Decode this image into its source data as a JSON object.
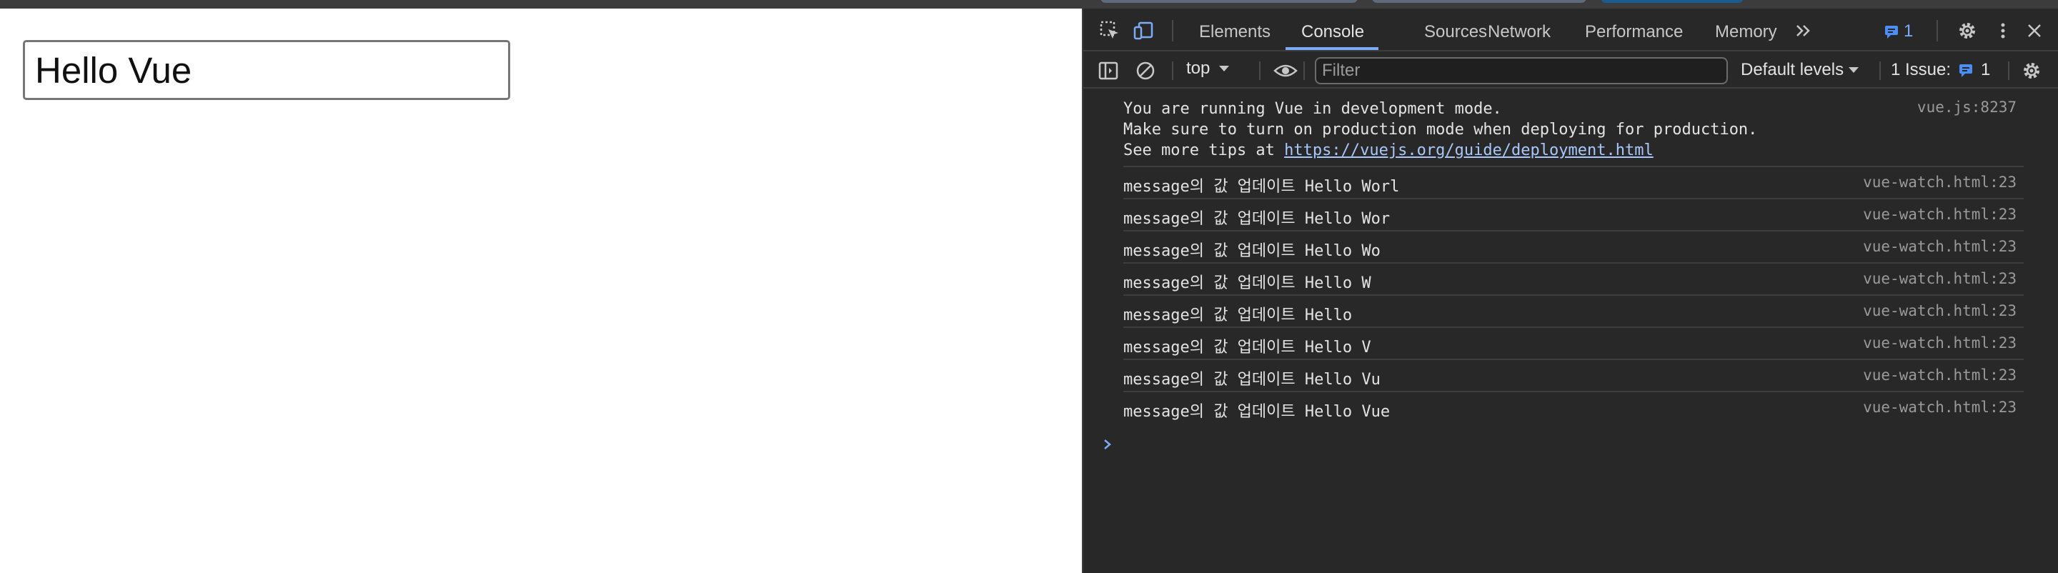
{
  "colors": {
    "accent": "#7cacf8",
    "issue_blue": "#4c8df6",
    "panel_bg": "#282828",
    "link": "#a8c7fa"
  },
  "page": {
    "input": {
      "value": "Hello Vue"
    }
  },
  "devtools": {
    "tabs": [
      "Elements",
      "Console",
      "Sources",
      "Network",
      "Performance",
      "Memory"
    ],
    "active_tab": "Console",
    "issues_badge": "1",
    "toolbar": {
      "context": "top",
      "filter_placeholder": "Filter",
      "levels": "Default levels",
      "issues_label": "1 Issue:",
      "issues_count": "1"
    },
    "console": {
      "intro": {
        "line1": "You are running Vue in development mode.",
        "line2": "Make sure to turn on production mode when deploying for production.",
        "line3_prefix": "See more tips at ",
        "link": "https://vuejs.org/guide/deployment.html",
        "source": "vue.js:8237"
      },
      "messages": [
        {
          "text": "message의 값 업데이트 Hello Worl",
          "source": "vue-watch.html:23"
        },
        {
          "text": "message의 값 업데이트 Hello Wor",
          "source": "vue-watch.html:23"
        },
        {
          "text": "message의 값 업데이트 Hello Wo",
          "source": "vue-watch.html:23"
        },
        {
          "text": "message의 값 업데이트 Hello W",
          "source": "vue-watch.html:23"
        },
        {
          "text": "message의 값 업데이트 Hello",
          "source": "vue-watch.html:23"
        },
        {
          "text": "message의 값 업데이트 Hello V",
          "source": "vue-watch.html:23"
        },
        {
          "text": "message의 값 업데이트 Hello Vu",
          "source": "vue-watch.html:23"
        },
        {
          "text": "message의 값 업데이트 Hello Vue",
          "source": "vue-watch.html:23"
        }
      ],
      "prompt_icon": "chevron-right-icon"
    }
  }
}
